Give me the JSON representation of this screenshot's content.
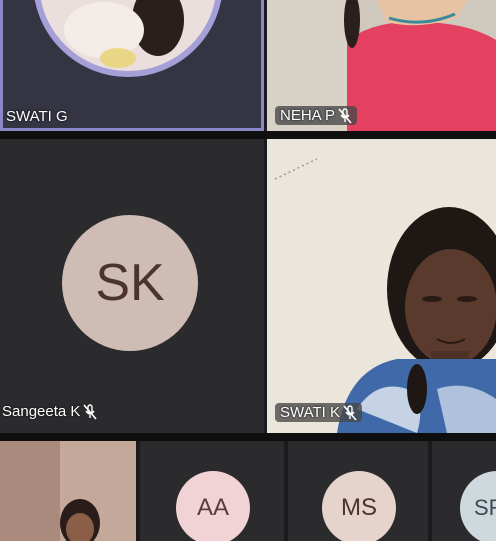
{
  "grid": {
    "tile_swati_g": {
      "label": "SWATI G",
      "muted": false,
      "active_speaker": true
    },
    "tile_neha_p": {
      "label": "NEHA P",
      "muted": true
    },
    "tile_sangeeta_k": {
      "label": "Sangeeta K",
      "initials": "SK",
      "muted": true
    },
    "tile_swati_k": {
      "label": "SWATI K",
      "muted": true
    },
    "bottom_row": [
      {
        "type": "video"
      },
      {
        "initials": "AA",
        "avatar_color": "#f1d3d6"
      },
      {
        "initials": "MS",
        "avatar_color": "#e6d3cb"
      },
      {
        "initials": "SR",
        "avatar_color": "#cfd8dc"
      }
    ]
  },
  "colors": {
    "tile_bg": "#2b2b2e",
    "active_border": "#8b86c7",
    "avatar_sk": "#cfbcb5",
    "avatar_text": "#4c332d"
  }
}
